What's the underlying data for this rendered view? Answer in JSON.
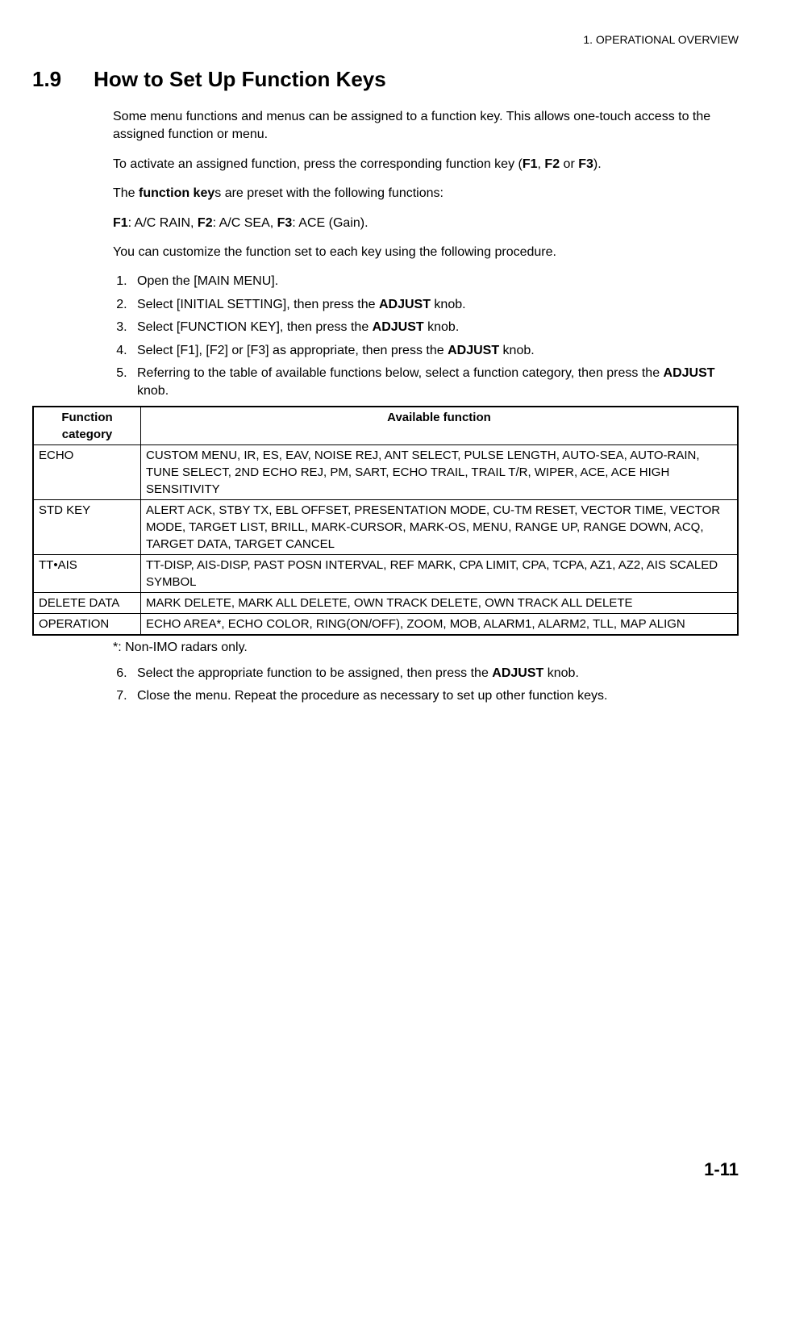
{
  "header": {
    "chapter": "1.  OPERATIONAL OVERVIEW"
  },
  "section": {
    "number": "1.9",
    "title": "How to Set Up Function Keys"
  },
  "intro": {
    "p1": "Some menu functions and menus can be assigned to a function key. This allows one-touch access to the assigned function or menu.",
    "p2a": "To activate an assigned function, press the corresponding function key (",
    "p2_f1": "F1",
    "p2_sep1": ", ",
    "p2_f2": "F2",
    "p2_sep2": " or ",
    "p2_f3": "F3",
    "p2b": ").",
    "p3a": "The ",
    "p3b": "function key",
    "p3c": "s are preset with the following functions:",
    "p4_f1": "F1",
    "p4_v1": ": A/C RAIN, ",
    "p4_f2": "F2",
    "p4_v2": ": A/C SEA, ",
    "p4_f3": "F3",
    "p4_v3": ": ACE (Gain).",
    "p5": "You can customize the function set to each key using the following procedure."
  },
  "steps": {
    "s1": "Open the [MAIN MENU].",
    "s2a": "Select [INITIAL SETTING], then press the ",
    "s2b": "ADJUST",
    "s2c": " knob.",
    "s3a": "Select [FUNCTION KEY], then press the ",
    "s3b": "ADJUST",
    "s3c": " knob.",
    "s4a": "Select [F1], [F2] or [F3] as appropriate, then press the ",
    "s4b": "ADJUST",
    "s4c": " knob.",
    "s5a": "Referring to the table of available functions below, select a function category, then press the ",
    "s5b": "ADJUST",
    "s5c": " knob."
  },
  "table": {
    "header": {
      "col1": "Function category",
      "col2": "Available function"
    },
    "rows": {
      "r1c1": "ECHO",
      "r1c2": "CUSTOM MENU, IR, ES, EAV, NOISE REJ, ANT SELECT, PULSE LENGTH, AUTO-SEA, AUTO-RAIN, TUNE SELECT, 2ND ECHO REJ, PM, SART, ECHO TRAIL, TRAIL T/R, WIPER, ACE, ACE HIGH SENSITIVITY",
      "r2c1": "STD KEY",
      "r2c2": "ALERT ACK, STBY TX, EBL OFFSET, PRESENTATION MODE, CU-TM RESET, VECTOR TIME, VECTOR MODE, TARGET LIST, BRILL, MARK-CURSOR, MARK-OS, MENU, RANGE UP, RANGE DOWN, ACQ, TARGET DATA, TARGET CANCEL",
      "r3c1": "TT•AIS",
      "r3c2": "TT-DISP, AIS-DISP, PAST POSN INTERVAL, REF MARK, CPA LIMIT, CPA, TCPA, AZ1, AZ2, AIS SCALED SYMBOL",
      "r4c1": "DELETE DATA",
      "r4c2": "MARK DELETE, MARK ALL DELETE, OWN TRACK DELETE, OWN TRACK ALL DELETE",
      "r5c1": "OPERATION",
      "r5c2": "ECHO AREA*, ECHO COLOR, RING(ON/OFF), ZOOM, MOB, ALARM1, ALARM2, TLL, MAP ALIGN"
    }
  },
  "footnote": "*: Non-IMO radars only.",
  "steps2": {
    "s6a": "Select the appropriate function to be assigned, then press the ",
    "s6b": "ADJUST",
    "s6c": " knob.",
    "s7": "Close the menu. Repeat the procedure as necessary to set up other function keys."
  },
  "page_number": "1-11"
}
